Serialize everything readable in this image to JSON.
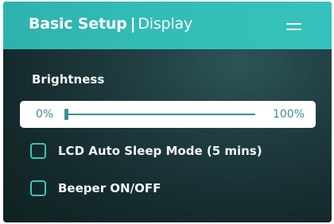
{
  "header": {
    "title": "Basic Setup",
    "separator": "|",
    "subtitle": "Display",
    "menu_icon": "hamburger-menu-icon"
  },
  "brightness": {
    "label": "Brightness",
    "min_label": "0%",
    "max_label": "100%",
    "value_percent": 0
  },
  "options": [
    {
      "label": "LCD Auto Sleep Mode (5 mins)",
      "checked": false
    },
    {
      "label": "Beeper ON/OFF",
      "checked": false
    }
  ],
  "colors": {
    "header_accent": "#33bcb6",
    "checkbox_border": "#3fc3bd",
    "slider": "#3c8f91"
  }
}
